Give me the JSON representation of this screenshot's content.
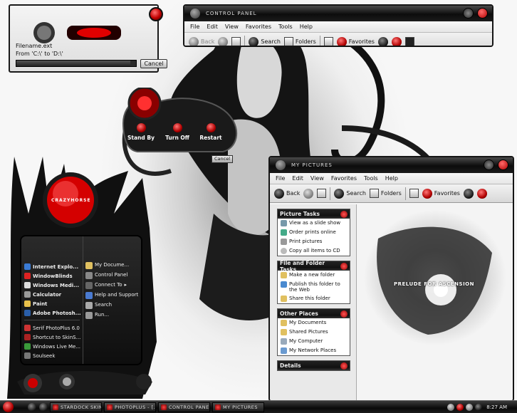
{
  "copy_dialog": {
    "filename": "Filename.ext",
    "from_to": "From 'C:\\' to 'D:\\'",
    "cancel": "Cancel",
    "progress": 0.95
  },
  "logo": {
    "text": "CRAZYHORSE"
  },
  "shutdown": {
    "stand_by": "Stand By",
    "turn_off": "Turn Off",
    "restart": "Restart",
    "cancel": "Cancel"
  },
  "control_panel": {
    "title": "CONTROL PANEL",
    "menu": [
      "File",
      "Edit",
      "View",
      "Favorites",
      "Tools",
      "Help"
    ],
    "toolbar": {
      "back": "Back",
      "search": "Search",
      "folders": "Folders",
      "favorites": "Favorites"
    }
  },
  "my_pictures": {
    "title": "MY PICTURES",
    "menu": [
      "File",
      "Edit",
      "View",
      "Favorites",
      "Tools",
      "Help"
    ],
    "toolbar": {
      "back": "Back",
      "search": "Search",
      "folders": "Folders",
      "favorites": "Favorites"
    },
    "panes": {
      "picture_tasks": {
        "title": "Picture Tasks",
        "items": [
          "View as a slide show",
          "Order prints online",
          "Print pictures",
          "Copy all items to CD"
        ]
      },
      "file_folder_tasks": {
        "title": "File and Folder Tasks",
        "items": [
          "Make a new folder",
          "Publish this folder to the Web",
          "Share this folder"
        ]
      },
      "other_places": {
        "title": "Other Places",
        "items": [
          "My Documents",
          "Shared Pictures",
          "My Computer",
          "My Network Places"
        ]
      },
      "details": {
        "title": "Details"
      }
    },
    "image_caption": "PRELUDE FOR ASCENSION"
  },
  "start_menu": {
    "pinned": [
      "Internet Explo...",
      "WindowBlinds",
      "Windows Medi...",
      "Calculator",
      "Paint",
      "Adobe Photosh..."
    ],
    "recent": [
      "Serif PhotoPlus 6.0",
      "Shortcut to SkinS...",
      "Windows Live Me...",
      "Soulseek"
    ],
    "right": [
      "My Docume...",
      "Control Panel",
      "Connect To",
      "Help and Support",
      "Search",
      "Run..."
    ]
  },
  "taskbar": {
    "tasks": [
      "STARDOCK SKIN...",
      "PHOTOPLUS - [...",
      "CONTROL PANEL",
      "MY PICTURES"
    ],
    "clock": "8:27 AM"
  },
  "colors": {
    "accent": "#c00000",
    "chrome_dark": "#111111",
    "window_bg": "#f5f5f5"
  }
}
